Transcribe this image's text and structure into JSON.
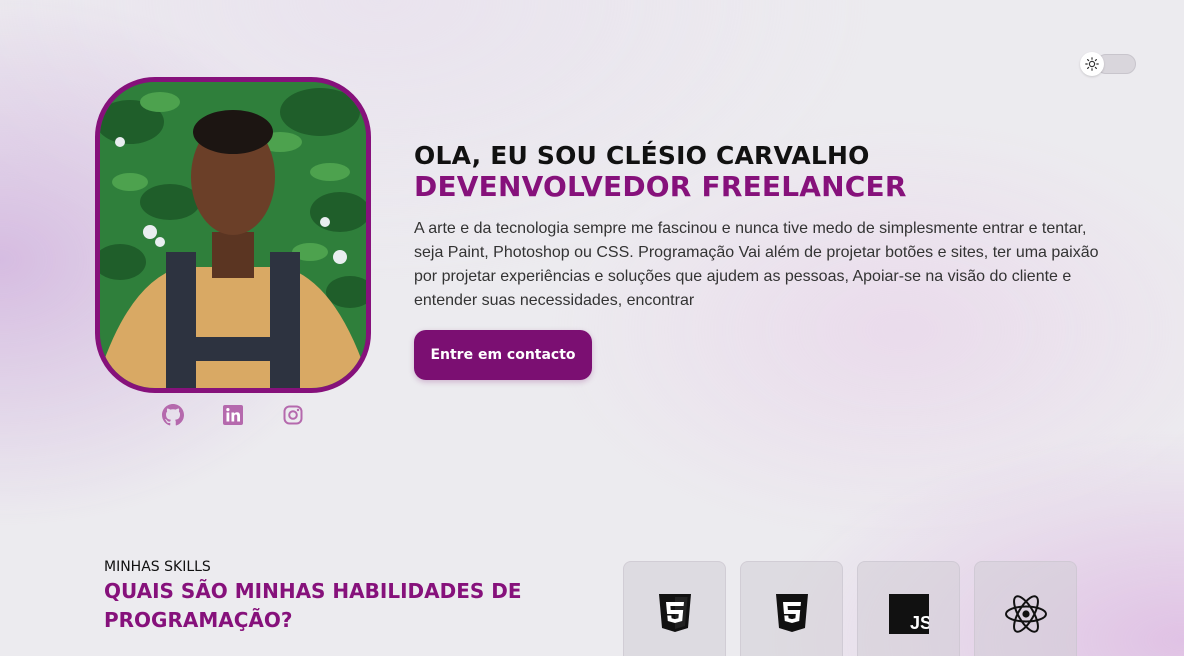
{
  "theme_toggle": {
    "icon": "sun-icon",
    "state": "light"
  },
  "hero": {
    "photo_alt": "profile-photo",
    "greeting": "OLA, EU SOU CLÉSIO CARVALHO",
    "role": "DEVENVOLVEDOR FREELANCER",
    "bio": "A arte e da tecnologia sempre me fascinou e nunca tive medo de simplesmente entrar e tentar, seja Paint, Photoshop ou CSS. Programação Vai além de projetar botões e sites, ter uma paixão por projetar experiências e soluções que ajudem as pessoas, Apoiar-se na visão do cliente e entender suas necessidades, encontrar",
    "cta_label": "Entre em contacto"
  },
  "socials": [
    {
      "icon": "github-icon"
    },
    {
      "icon": "linkedin-icon"
    },
    {
      "icon": "instagram-icon"
    }
  ],
  "skills": {
    "kicker": "MINHAS SKILLS",
    "title": "QUAIS SÃO MINHAS HABILIDADES DE PROGRAMAÇÃO?",
    "cards": [
      {
        "icon": "html5-icon"
      },
      {
        "icon": "css3-icon"
      },
      {
        "icon": "javascript-icon"
      },
      {
        "icon": "react-icon"
      }
    ]
  },
  "colors": {
    "accent": "#86117b",
    "button": "#7b0f72",
    "social_icons": "#b569ad",
    "text_dark": "#111111"
  }
}
